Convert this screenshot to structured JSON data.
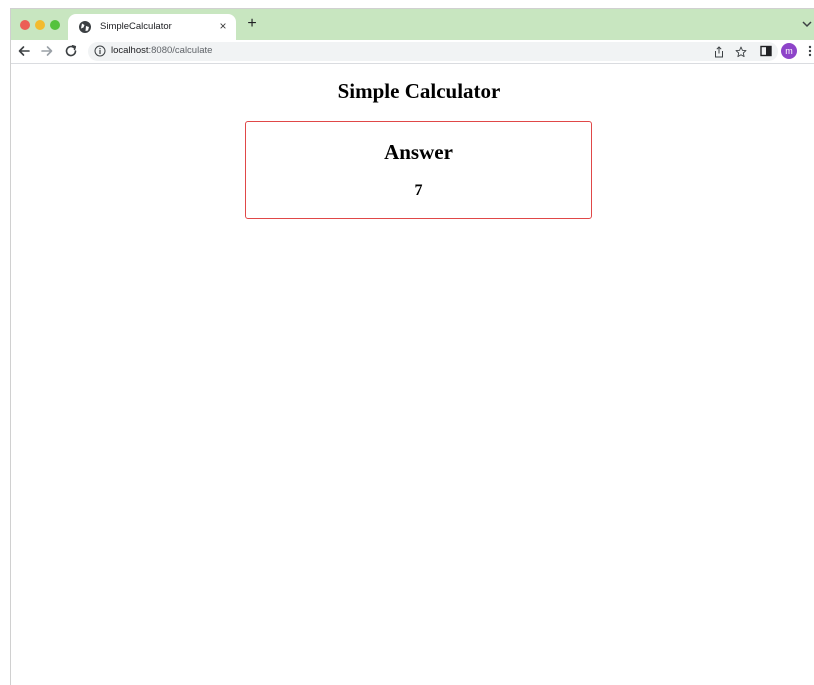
{
  "browser": {
    "tab_title": "SimpleCalculator",
    "tab_close": "×",
    "new_tab": "+",
    "url_host": "localhost",
    "url_rest": ":8080/calculate",
    "avatar_letter": "m",
    "colors": {
      "tabstrip": "#c8e6c0",
      "avatar": "#8e44c9"
    }
  },
  "page": {
    "title": "Simple Calculator",
    "answer_heading": "Answer",
    "answer_value": "7",
    "colors": {
      "answer_border": "#e04848"
    }
  },
  "icons": {
    "favicon": "globe-icon",
    "back": "arrow-left-icon",
    "forward": "arrow-right-icon",
    "reload": "reload-icon",
    "info": "info-icon",
    "share": "share-icon",
    "bookmark": "star-icon",
    "sidepanel": "side-panel-icon",
    "menu": "kebab-menu-icon",
    "tab_search": "chevron-down-icon"
  }
}
